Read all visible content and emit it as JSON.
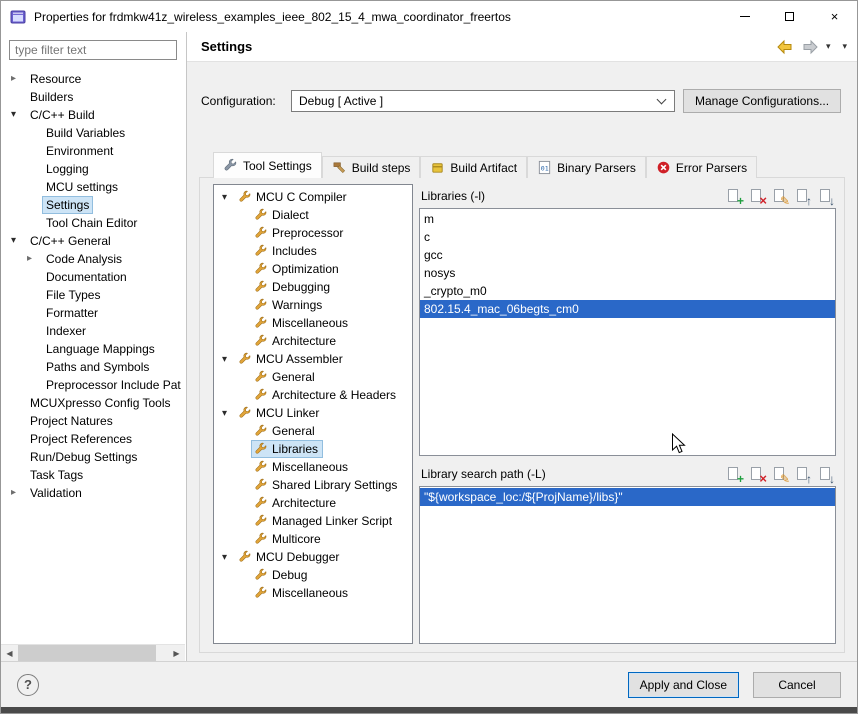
{
  "window": {
    "title": "Properties for frdmkw41z_wireless_examples_ieee_802_15_4_mwa_coordinator_freertos"
  },
  "colors": {
    "selection_blue": "#2a68c8",
    "tree_selection": "#cde4f6",
    "default_button_border": "#0067c0"
  },
  "sidebar": {
    "filter_placeholder": "type filter text",
    "items": [
      {
        "label": "Resource",
        "arrow": "col"
      },
      {
        "label": "Builders"
      },
      {
        "label": "C/C++ Build",
        "arrow": "exp"
      },
      {
        "label": "Build Variables",
        "indent": 1
      },
      {
        "label": "Environment",
        "indent": 1
      },
      {
        "label": "Logging",
        "indent": 1
      },
      {
        "label": "MCU settings",
        "indent": 1
      },
      {
        "label": "Settings",
        "indent": 1,
        "selected": true
      },
      {
        "label": "Tool Chain Editor",
        "indent": 1
      },
      {
        "label": "C/C++ General",
        "arrow": "exp"
      },
      {
        "label": "Code Analysis",
        "indent": 1,
        "arrow": "col"
      },
      {
        "label": "Documentation",
        "indent": 1
      },
      {
        "label": "File Types",
        "indent": 1
      },
      {
        "label": "Formatter",
        "indent": 1
      },
      {
        "label": "Indexer",
        "indent": 1
      },
      {
        "label": "Language Mappings",
        "indent": 1
      },
      {
        "label": "Paths and Symbols",
        "indent": 1
      },
      {
        "label": "Preprocessor Include Pat",
        "indent": 1
      },
      {
        "label": "MCUXpresso Config Tools"
      },
      {
        "label": "Project Natures"
      },
      {
        "label": "Project References"
      },
      {
        "label": "Run/Debug Settings"
      },
      {
        "label": "Task Tags"
      },
      {
        "label": "Validation",
        "arrow": "col"
      }
    ]
  },
  "header": {
    "title": "Settings"
  },
  "config": {
    "label": "Configuration:",
    "value": "Debug  [ Active ]",
    "manage_button": "Manage Configurations..."
  },
  "tabs": [
    {
      "label": "Tool Settings",
      "selected": true
    },
    {
      "label": "Build steps"
    },
    {
      "label": "Build Artifact"
    },
    {
      "label": "Binary Parsers"
    },
    {
      "label": "Error Parsers"
    }
  ],
  "tool_tree": [
    {
      "label": "MCU C Compiler",
      "type": "group"
    },
    {
      "label": "Dialect"
    },
    {
      "label": "Preprocessor"
    },
    {
      "label": "Includes"
    },
    {
      "label": "Optimization"
    },
    {
      "label": "Debugging"
    },
    {
      "label": "Warnings"
    },
    {
      "label": "Miscellaneous"
    },
    {
      "label": "Architecture"
    },
    {
      "label": "MCU Assembler",
      "type": "group"
    },
    {
      "label": "General"
    },
    {
      "label": "Architecture & Headers"
    },
    {
      "label": "MCU Linker",
      "type": "group"
    },
    {
      "label": "General"
    },
    {
      "label": "Libraries",
      "selected": true
    },
    {
      "label": "Miscellaneous"
    },
    {
      "label": "Shared Library Settings"
    },
    {
      "label": "Architecture"
    },
    {
      "label": "Managed Linker Script"
    },
    {
      "label": "Multicore"
    },
    {
      "label": "MCU Debugger",
      "type": "group"
    },
    {
      "label": "Debug"
    },
    {
      "label": "Miscellaneous"
    }
  ],
  "libraries": {
    "title": "Libraries (-l)",
    "items": [
      {
        "label": "m"
      },
      {
        "label": "c"
      },
      {
        "label": "gcc"
      },
      {
        "label": "nosys"
      },
      {
        "label": "_crypto_m0"
      },
      {
        "label": "802.15.4_mac_06begts_cm0",
        "selected": true
      }
    ]
  },
  "search_path": {
    "title": "Library search path (-L)",
    "items": [
      {
        "label": "\"${workspace_loc:/${ProjName}/libs}\"",
        "selected": true
      }
    ]
  },
  "footer": {
    "apply": "Apply and Close",
    "cancel": "Cancel"
  }
}
